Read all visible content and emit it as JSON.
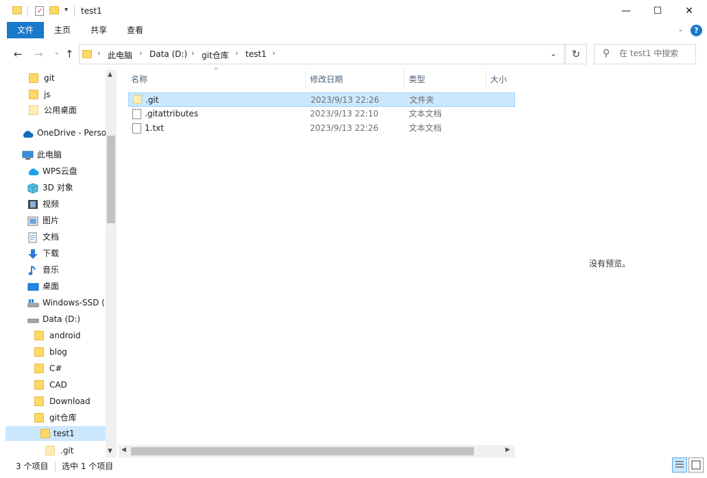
{
  "window": {
    "title": "test1",
    "minimize_glyph": "—",
    "maximize_glyph": "☐",
    "close_glyph": "✕"
  },
  "ribbon": {
    "tabs": [
      "文件",
      "主页",
      "共享",
      "查看"
    ]
  },
  "address": {
    "crumbs": [
      "此电脑",
      "Data (D:)",
      "git仓库",
      "test1"
    ],
    "search_placeholder": "在 test1 中搜索"
  },
  "nav": {
    "items": [
      {
        "label": "git",
        "icon": "folder-icon"
      },
      {
        "label": "js",
        "icon": "folder-icon"
      },
      {
        "label": "公用桌面",
        "icon": "folder-icon"
      },
      {
        "label": "OneDrive - Perso",
        "icon": "onedrive-cloud-icon"
      },
      {
        "label": "此电脑",
        "icon": "this-pc-icon"
      },
      {
        "label": "WPS云盘",
        "icon": "wps-cloud-icon"
      },
      {
        "label": "3D 对象",
        "icon": "3d-objects-icon"
      },
      {
        "label": "视频",
        "icon": "video-icon"
      },
      {
        "label": "图片",
        "icon": "pictures-icon"
      },
      {
        "label": "文档",
        "icon": "documents-icon"
      },
      {
        "label": "下载",
        "icon": "download-icon"
      },
      {
        "label": "音乐",
        "icon": "music-icon"
      },
      {
        "label": "桌面",
        "icon": "desktop-icon"
      },
      {
        "label": "Windows-SSD (",
        "icon": "windows-drive-icon"
      },
      {
        "label": "Data (D:)",
        "icon": "drive-icon"
      },
      {
        "label": "android",
        "icon": "folder-icon"
      },
      {
        "label": "blog",
        "icon": "folder-icon"
      },
      {
        "label": "C#",
        "icon": "folder-icon"
      },
      {
        "label": "CAD",
        "icon": "folder-icon"
      },
      {
        "label": "Download",
        "icon": "folder-icon"
      },
      {
        "label": "git仓库",
        "icon": "folder-icon"
      },
      {
        "label": "test1",
        "icon": "folder-icon"
      },
      {
        "label": ".git",
        "icon": "folder-icon"
      }
    ]
  },
  "files": {
    "columns": [
      "名称",
      "修改日期",
      "类型",
      "大小"
    ],
    "rows": [
      {
        "name": ".git",
        "date": "2023/9/13 22:26",
        "type": "文件夹"
      },
      {
        "name": ".gitattributes",
        "date": "2023/9/13 22:10",
        "type": "文本文档"
      },
      {
        "name": "1.txt",
        "date": "2023/9/13 22:26",
        "type": "文本文档"
      }
    ]
  },
  "preview": {
    "empty_text": "没有预览。"
  },
  "status": {
    "item_count": "3 个项目",
    "selected": "选中 1 个项目"
  },
  "colors": {
    "accent": "#1979ca",
    "selection": "#cce8ff",
    "folder": "#ffd966"
  }
}
